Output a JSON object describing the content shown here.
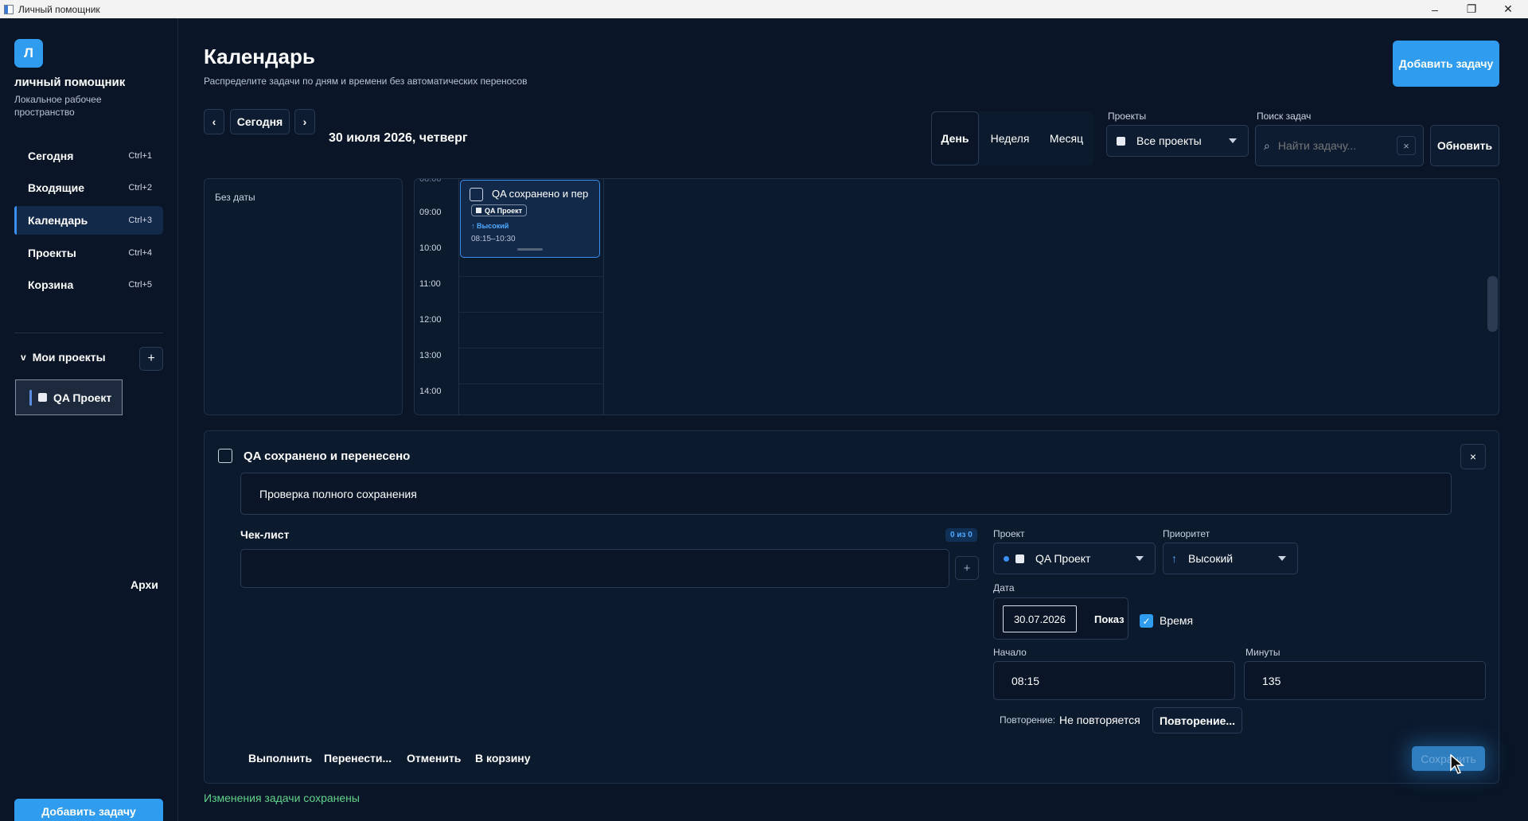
{
  "window": {
    "title": "Личный помощник",
    "minimize": "–",
    "maximize": "❐",
    "close": "✕"
  },
  "sidebar": {
    "logo_letter": "Л",
    "app_name": "личный помощник",
    "app_subtitle": "Локальное рабочее пространство",
    "items": [
      {
        "label": "Сегодня",
        "shortcut": "Ctrl+1"
      },
      {
        "label": "Входящие",
        "shortcut": "Ctrl+2"
      },
      {
        "label": "Календарь",
        "shortcut": "Ctrl+3"
      },
      {
        "label": "Проекты",
        "shortcut": "Ctrl+4"
      },
      {
        "label": "Корзина",
        "shortcut": "Ctrl+5"
      }
    ],
    "my_projects_label": "Мои проекты",
    "add_project": "+",
    "projects": [
      {
        "name": "QA Проект"
      }
    ],
    "archive_label": "Архи",
    "add_task": "Добавить задачу"
  },
  "header": {
    "title": "Календарь",
    "subtitle": "Распределите задачи по дням и времени без автоматических переносов",
    "add_task": "Добавить задачу",
    "prev": "‹",
    "today": "Сегодня",
    "next": "›",
    "current_date": "30 июля 2026, четверг",
    "views": {
      "day": "День",
      "week": "Неделя",
      "month": "Месяц"
    },
    "projects_label": "Проекты",
    "projects_value": "Все проекты",
    "search_label": "Поиск задач",
    "search_placeholder": "Найти задачу...",
    "search_clear": "×",
    "refresh": "Обновить"
  },
  "calendar": {
    "no_date_label": "Без даты",
    "hours": [
      "09:00",
      "10:00",
      "11:00",
      "12:00",
      "13:00",
      "14:00"
    ],
    "event": {
      "title": "QA сохранено и пер",
      "project": "QA Проект",
      "priority": "↑ Высокий",
      "time": "08:15–10:30"
    }
  },
  "detail": {
    "title": "QA сохранено и перенесено",
    "close": "×",
    "description": "Проверка полного сохранения",
    "checklist_label": "Чек-лист",
    "checklist_count": "0 из 0",
    "checklist_add": "+",
    "project_label": "Проект",
    "project_value": "QA Проект",
    "priority_label": "Приоритет",
    "priority_value": "Высокий",
    "priority_icon": "↑",
    "date_label": "Дата",
    "date_value": "30.07.2026",
    "show_button": "Показ",
    "time_checkbox_label": "Время",
    "start_label": "Начало",
    "start_value": "08:15",
    "minutes_label": "Минуты",
    "minutes_value": "135",
    "repeat_label": "Повторение:",
    "repeat_value": "Не повторяется",
    "repeat_button": "Повторение...",
    "actions": {
      "complete": "Выполнить",
      "move": "Перенести...",
      "cancel": "Отменить",
      "trash": "В корзину"
    },
    "save": "Сохранить"
  },
  "status_message": "Изменения задачи сохранены",
  "colors": {
    "accent": "#2f9cf0",
    "background": "#0a1628",
    "success": "#5fd38a"
  }
}
